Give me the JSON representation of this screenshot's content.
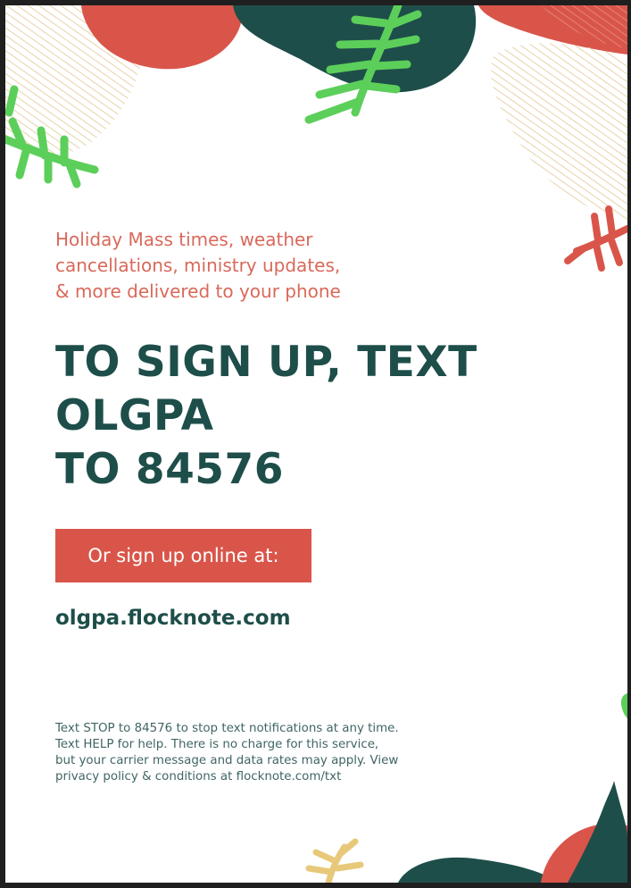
{
  "intro_lines": [
    "Holiday Mass times, weather",
    "cancellations, ministry updates,",
    "& more delivered to your phone"
  ],
  "headline_lines": [
    "TO SIGN UP, TEXT",
    "OLGPA",
    "TO 84576"
  ],
  "cta_label": "Or sign up online at:",
  "website": "olgpa.flocknote.com",
  "legal_lines": [
    "Text STOP to 84576 to stop text notifications at any time.",
    "Text HELP for help. There is no charge for this service,",
    "but your carrier message and data rates may apply. View",
    "privacy policy & conditions at flocknote.com/txt"
  ],
  "colors": {
    "coral": "#d9554a",
    "teal": "#1e4e4a",
    "leaf_green": "#5ccf5a",
    "sand_stripes": "#e6d3a8"
  }
}
